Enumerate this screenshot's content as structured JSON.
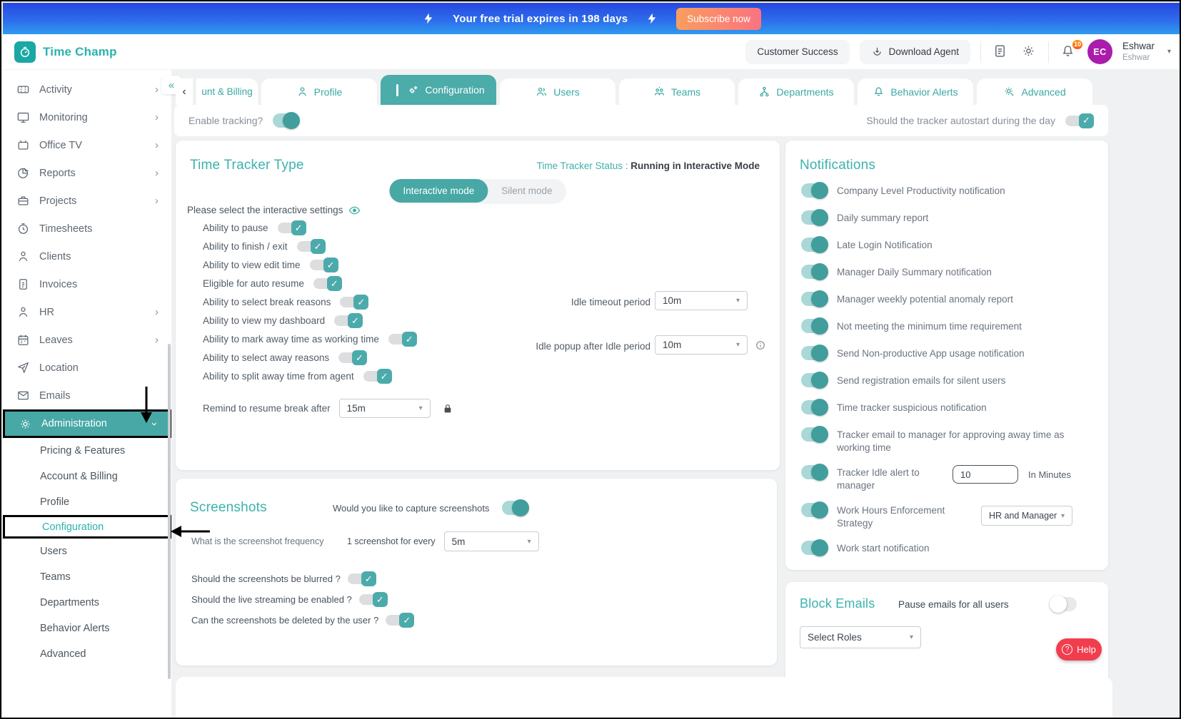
{
  "banner": {
    "text": "Your free trial expires in 198 days",
    "subscribe_label": "Subscribe now"
  },
  "brand": {
    "name": "Time Champ",
    "logo_icon": "stopwatch-icon"
  },
  "header": {
    "customer_success_label": "Customer Success",
    "download_agent_label": "Download Agent",
    "bell_badge": "10",
    "avatar_initials": "EC",
    "user_name": "Eshwar",
    "user_sub": "Eshwar"
  },
  "sidebar": {
    "items": [
      {
        "label": "Activity",
        "icon": "activity-icon",
        "expandable": true
      },
      {
        "label": "Monitoring",
        "icon": "monitor-icon",
        "expandable": true
      },
      {
        "label": "Office TV",
        "icon": "tv-icon",
        "expandable": true
      },
      {
        "label": "Reports",
        "icon": "pie-chart-icon",
        "expandable": true
      },
      {
        "label": "Projects",
        "icon": "briefcase-icon",
        "expandable": true
      },
      {
        "label": "Timesheets",
        "icon": "stopwatch-icon"
      },
      {
        "label": "Clients",
        "icon": "person-icon"
      },
      {
        "label": "Invoices",
        "icon": "invoice-icon"
      },
      {
        "label": "HR",
        "icon": "person-icon",
        "expandable": true
      },
      {
        "label": "Leaves",
        "icon": "calendar-icon",
        "expandable": true
      },
      {
        "label": "Location",
        "icon": "paper-plane-icon"
      },
      {
        "label": "Emails",
        "icon": "envelope-icon"
      },
      {
        "label": "Administration",
        "icon": "gear-icon",
        "expanded": true
      }
    ],
    "admin_children": [
      {
        "label": "Pricing & Features"
      },
      {
        "label": "Account & Billing"
      },
      {
        "label": "Profile"
      },
      {
        "label": "Configuration",
        "active": true
      },
      {
        "label": "Users"
      },
      {
        "label": "Teams"
      },
      {
        "label": "Departments"
      },
      {
        "label": "Behavior Alerts"
      },
      {
        "label": "Advanced"
      }
    ]
  },
  "tabs": [
    {
      "label": "unt & Billing"
    },
    {
      "label": "Profile",
      "icon": "person-icon"
    },
    {
      "label": "Configuration",
      "icon": "gears-icon",
      "active": true
    },
    {
      "label": "Users",
      "icon": "people-icon"
    },
    {
      "label": "Teams",
      "icon": "team-icon"
    },
    {
      "label": "Departments",
      "icon": "hierarchy-icon"
    },
    {
      "label": "Behavior Alerts",
      "icon": "bell-icon"
    },
    {
      "label": "Advanced",
      "icon": "gear-wrench-icon"
    }
  ],
  "tracking_bar": {
    "enable_label": "Enable tracking?",
    "autostart_label": "Should the tracker autostart during the day"
  },
  "tracker_card": {
    "title": "Time Tracker Type",
    "status_label": "Time Tracker Status :",
    "status_value": "Running in Interactive Mode",
    "mode_active": "Interactive mode",
    "mode_inactive": "Silent mode",
    "settings_prompt": "Please select the interactive settings",
    "settings": [
      "Ability to pause",
      "Ability to finish / exit",
      "Ability to view edit time",
      "Eligible for auto resume",
      "Ability to select break reasons",
      "Ability to view my dashboard",
      "Ability to mark away time as working time",
      "Ability to select away reasons",
      "Ability to split away time from agent"
    ],
    "idle_timeout_label": "Idle timeout period",
    "idle_timeout_value": "10m",
    "idle_popup_label": "Idle popup after Idle period",
    "idle_popup_value": "10m",
    "remind_label": "Remind to resume break after",
    "remind_value": "15m"
  },
  "notifications": {
    "title": "Notifications",
    "items": [
      "Company Level Productivity notification",
      "Daily summary report",
      "Late Login Notification",
      "Manager Daily Summary notification",
      "Manager weekly potential anomaly report",
      "Not meeting the minimum time requirement",
      "Send Non-productive App usage notification",
      "Send registration emails for silent users",
      "Time tracker suspicious notification",
      "Tracker email to manager for approving away time as working time"
    ],
    "idle_alert_label": "Tracker Idle alert to manager",
    "idle_alert_value": "10",
    "idle_alert_suffix": "In Minutes",
    "work_hours_label": "Work Hours Enforcement Strategy",
    "work_hours_value": "HR and Manager",
    "work_start_label": "Work start notification"
  },
  "screenshots": {
    "title": "Screenshots",
    "capture_label": "Would you like to capture screenshots",
    "frequency_label": "What is the screenshot frequency",
    "frequency_prefix": "1 screenshot for every",
    "frequency_value": "5m",
    "blurred_label": "Should the screenshots be blurred ?",
    "streaming_label": "Should the live streaming be enabled ?",
    "deleted_label": "Can the screenshots be deleted by the user ?"
  },
  "block_emails": {
    "title": "Block Emails",
    "pause_label": "Pause emails for all users",
    "roles_value": "Select Roles"
  },
  "help": {
    "label": "Help"
  },
  "colors": {
    "accent_teal": "#47a8a5",
    "teal_text": "#35b1ad",
    "banner_blue_top": "#2647e0",
    "banner_blue_bottom": "#2f9bf0",
    "subscribe_gradient": [
      "#f99d5f",
      "#fa7480"
    ],
    "badge_orange": "#ff7a1a",
    "avatar_purple": "#aa1cab",
    "help_red": "#f23d4e"
  }
}
